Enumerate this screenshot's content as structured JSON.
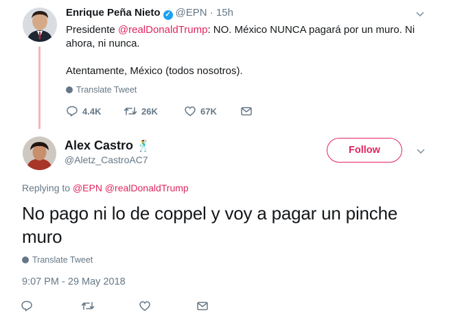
{
  "colors": {
    "accent": "#e0245e",
    "secondary": "#657786",
    "verified": "#1da1f2",
    "thread_line": "#f4b5be"
  },
  "tweet1": {
    "author_name": "Enrique Peña Nieto",
    "handle": "@EPN",
    "time": "· 15h",
    "text_prefix": "Presidente ",
    "mention": "@realDonaldTrump",
    "text_rest": ": NO. México NUNCA pagará por un muro. Ni ahora, ni nunca.",
    "signoff": "Atentamente, México (todos nosotros).",
    "translate_label": "Translate Tweet",
    "replies": "4.4K",
    "retweets": "26K",
    "likes": "67K",
    "icons": [
      "reply-icon",
      "retweet-icon",
      "like-icon",
      "message-icon",
      "chevron-down-icon",
      "verified-icon"
    ]
  },
  "tweet2": {
    "author_name": "Alex Castro",
    "emoji": "🕺",
    "handle": "@Aletz_CastroAC7",
    "follow_label": "Follow",
    "replying_prefix": "Replying to ",
    "replying_to_1": "@EPN",
    "replying_to_2": "@realDonaldTrump",
    "text": "No pago ni lo de coppel y voy a pagar un pinche muro",
    "translate_label": "Translate Tweet",
    "timestamp": "9:07 PM - 29 May 2018",
    "icons": [
      "reply-icon",
      "retweet-icon",
      "like-icon",
      "message-icon",
      "chevron-down-icon"
    ]
  }
}
